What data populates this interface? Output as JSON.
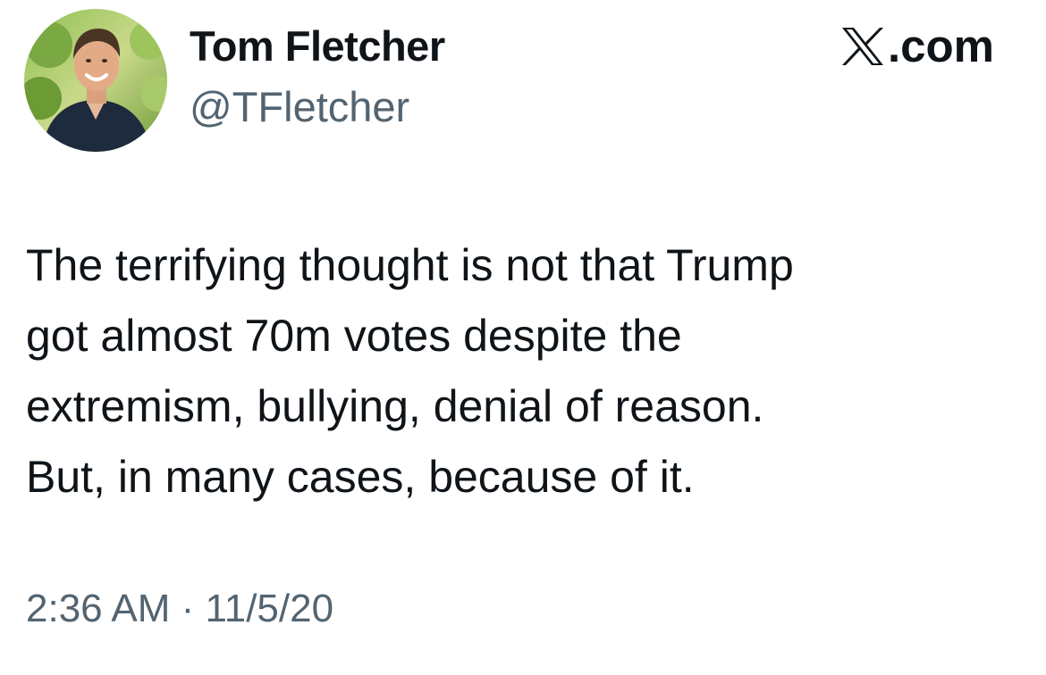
{
  "author": {
    "display_name": "Tom Fletcher",
    "handle": "@TFletcher",
    "avatar_icon": "profile-photo-avatar"
  },
  "brand": {
    "label": ".com",
    "logo_icon": "x-logo-icon"
  },
  "tweet": {
    "text": "The terrifying thought is not that Trump\ngot almost 70m votes despite the\nextremism, bullying, denial of reason.\nBut, in many cases, because of it.",
    "timestamp": "2:36 AM · 11/5/20"
  },
  "colors": {
    "text": "#0f1419",
    "secondary_text": "#536471",
    "background": "#ffffff"
  }
}
